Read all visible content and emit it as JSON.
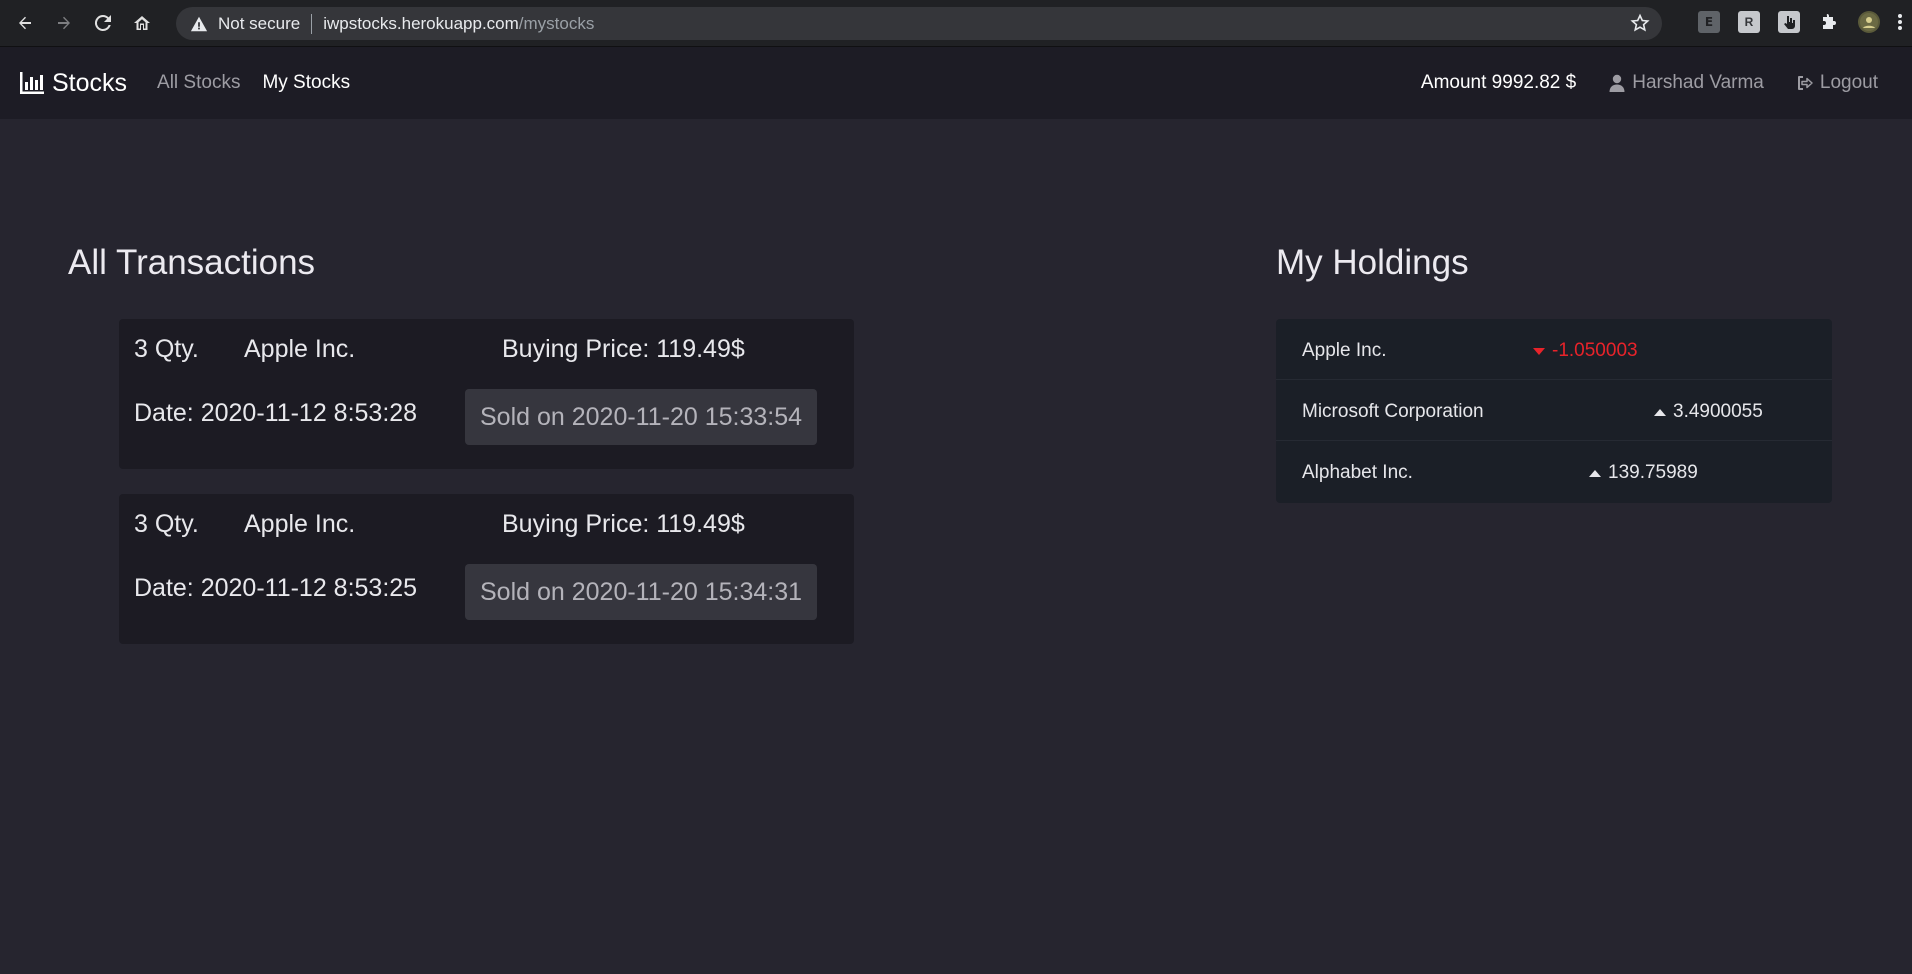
{
  "browser": {
    "security_label": "Not secure",
    "url_host": "iwpstocks.herokuapp.com",
    "url_path": "/mystocks",
    "extensions": [
      "E",
      "R"
    ]
  },
  "navbar": {
    "brand": "Stocks",
    "links": [
      {
        "label": "All Stocks",
        "active": false
      },
      {
        "label": "My Stocks",
        "active": true
      }
    ],
    "amount": "Amount 9992.82 $",
    "user": "Harshad Varma",
    "logout": "Logout"
  },
  "transactions": {
    "title": "All Transactions",
    "items": [
      {
        "qty": "3 Qty.",
        "company": "Apple Inc.",
        "price": "Buying Price: 119.49$",
        "date": "Date: 2020-11-12 8:53:28",
        "sold": "Sold on 2020-11-20 15:33:54"
      },
      {
        "qty": "3 Qty.",
        "company": "Apple Inc.",
        "price": "Buying Price: 119.49$",
        "date": "Date: 2020-11-12 8:53:25",
        "sold": "Sold on 2020-11-20 15:34:31"
      }
    ]
  },
  "holdings": {
    "title": "My Holdings",
    "items": [
      {
        "name": "Apple Inc.",
        "change": "-1.050003",
        "direction": "down"
      },
      {
        "name": "Microsoft Corporation",
        "change": "3.4900055",
        "direction": "up"
      },
      {
        "name": "Alphabet Inc.",
        "change": "139.75989",
        "direction": "up"
      }
    ]
  },
  "colors": {
    "page_bg": "#26252f",
    "navbar_bg": "#1d1c25",
    "down": "#e8232a",
    "up": "#e6e6ea"
  }
}
